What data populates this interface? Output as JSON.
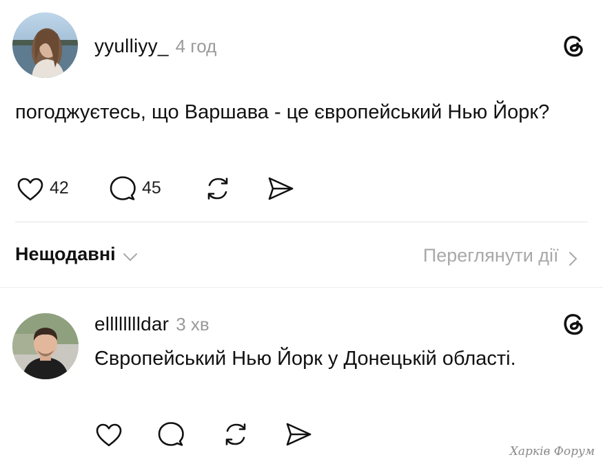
{
  "post": {
    "username": "yyulliyy_",
    "time": "4 год",
    "text": "погоджуєтесь, що Варшава - це європейський Нью Йорк?",
    "likes": "42",
    "replies": "45"
  },
  "filter_bar": {
    "sort_label": "Нещодавні",
    "view_activity_label": "Переглянути дії"
  },
  "reply": {
    "username": "elllllllldar",
    "time": "3 хв",
    "text": "Європейський Нью Йорк у Донецькій області."
  },
  "watermark": "Харків Форум",
  "icons": {
    "threads": "threads-logo-icon",
    "like": "heart-icon",
    "comment": "speech-bubble-icon",
    "repost": "repost-icon",
    "share": "send-icon"
  }
}
